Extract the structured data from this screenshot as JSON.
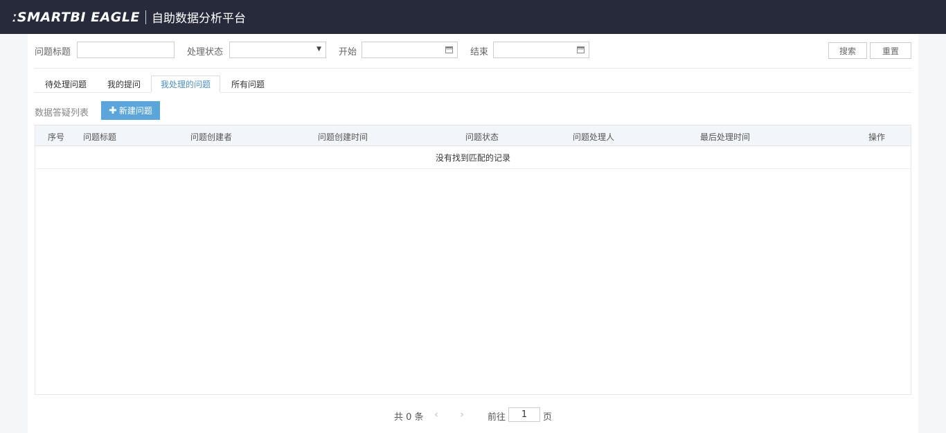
{
  "header": {
    "brand": "ːSMARTBI EAGLE",
    "product": "自助数据分析平台"
  },
  "filters": {
    "title_label": "问题标题",
    "title_value": "",
    "status_label": "处理状态",
    "status_value": "",
    "start_label": "开始",
    "start_value": "",
    "end_label": "结束",
    "end_value": "",
    "search_btn": "搜索",
    "reset_btn": "重置"
  },
  "tabs": [
    {
      "label": "待处理问题",
      "active": false
    },
    {
      "label": "我的提问",
      "active": false
    },
    {
      "label": "我处理的问题",
      "active": true
    },
    {
      "label": "所有问题",
      "active": false
    }
  ],
  "list": {
    "title": "数据答疑列表",
    "new_btn": "新建问题"
  },
  "table": {
    "columns": [
      "序号",
      "问题标题",
      "问题创建者",
      "问题创建时间",
      "问题状态",
      "问题处理人",
      "最后处理时间",
      "操作"
    ],
    "empty_text": "没有找到匹配的记录"
  },
  "pager": {
    "total": "共 0 条",
    "goto": "前往",
    "page": "1",
    "unit": "页"
  }
}
